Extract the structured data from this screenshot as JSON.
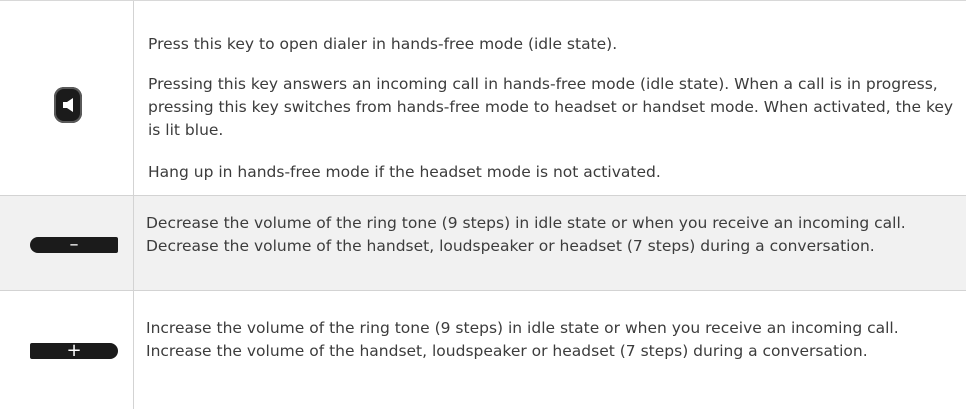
{
  "rows": [
    {
      "icon": "speaker-key-icon",
      "paragraphs": [
        "Press this key to open dialer in hands-free mode (idle state).",
        "Pressing this key answers an incoming call in hands-free mode (idle state). When a call is in progress, pressing this key switches from hands-free mode to headset or handset mode. When activated, the key is lit blue.",
        "Hang up in hands-free mode if the headset mode is not activated."
      ]
    },
    {
      "icon": "volume-down-key-icon",
      "key_symbol": "–",
      "paragraphs": [
        "Decrease the volume of the ring tone (9 steps) in idle state or when you receive an incoming call. Decrease the volume of the handset, loudspeaker or headset (7 steps) during a conversation."
      ]
    },
    {
      "icon": "volume-up-key-icon",
      "key_symbol": "+",
      "paragraphs": [
        "Increase the volume of the ring tone (9 steps) in idle state or when you receive an incoming call. Increase the volume of the handset, loudspeaker or headset (7 steps) during a conversation."
      ]
    }
  ]
}
